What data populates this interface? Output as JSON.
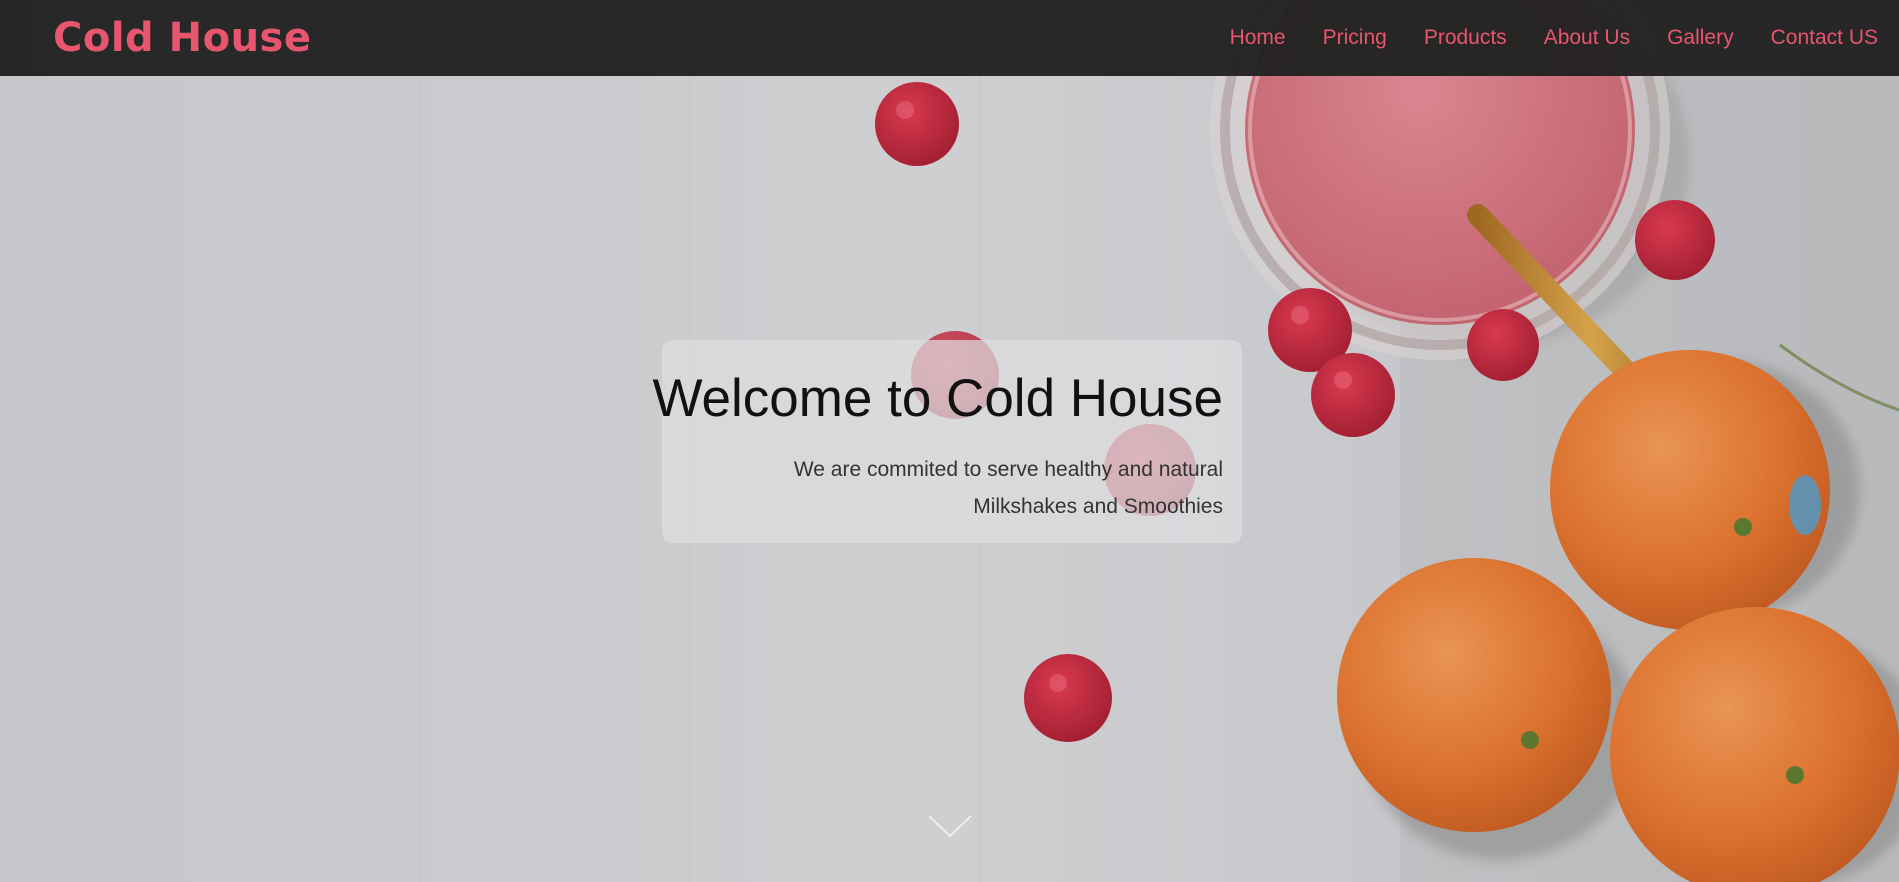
{
  "brand": {
    "name": "Cold House",
    "color": "#e8556f"
  },
  "nav": {
    "links": [
      {
        "label": "Home"
      },
      {
        "label": "Pricing"
      },
      {
        "label": "Products"
      },
      {
        "label": "About Us"
      },
      {
        "label": "Gallery"
      },
      {
        "label": "Contact US"
      }
    ]
  },
  "hero": {
    "title": "Welcome to Cold House",
    "subtitle_line1": "We are commited to serve healthy and natural",
    "subtitle_line2": "Milkshakes and Smoothies",
    "background_image": "smoothie-raspberries-oranges-photo",
    "scroll_icon": "chevron-down-icon"
  },
  "colors": {
    "navbar_bg": "#222222",
    "accent": "#e8556f",
    "hero_bg": "#d5d6da"
  }
}
